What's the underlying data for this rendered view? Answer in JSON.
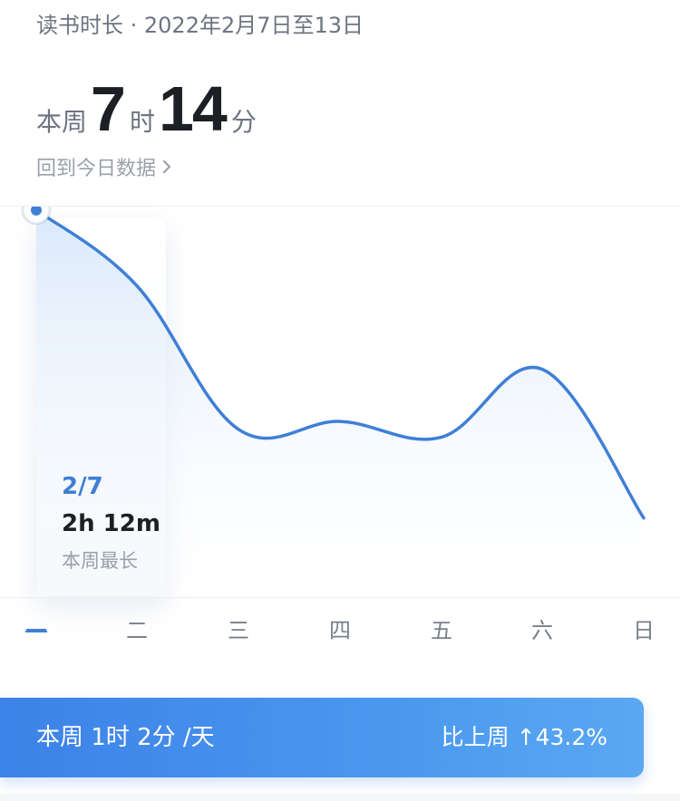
{
  "header": {
    "title": "读书时长 · 2022年2月7日至13日"
  },
  "summary": {
    "prefix": "本周",
    "hours": "7",
    "hours_unit": "时",
    "minutes": "14",
    "minutes_unit": "分",
    "back_link": "回到今日数据",
    "back_icon": "chevron-right-icon"
  },
  "chart_data": {
    "type": "line",
    "categories": [
      "一",
      "二",
      "三",
      "四",
      "五",
      "六",
      "日"
    ],
    "values_minutes": [
      132,
      103,
      48,
      51,
      45,
      71,
      14
    ],
    "selected_index": 0,
    "colors": {
      "line": "#3f7fd6",
      "area_top": "#d6e6fa",
      "area_bottom": "#ffffff"
    },
    "highlight": {
      "date": "2/7",
      "value": "2h 12m",
      "note": "本周最长"
    }
  },
  "footer_banner": {
    "left": "本周 1时 2分 /天",
    "right": "比上周 ↑43.2%",
    "colors": {
      "start": "#3d82e8",
      "end": "#5aa8f2"
    }
  }
}
